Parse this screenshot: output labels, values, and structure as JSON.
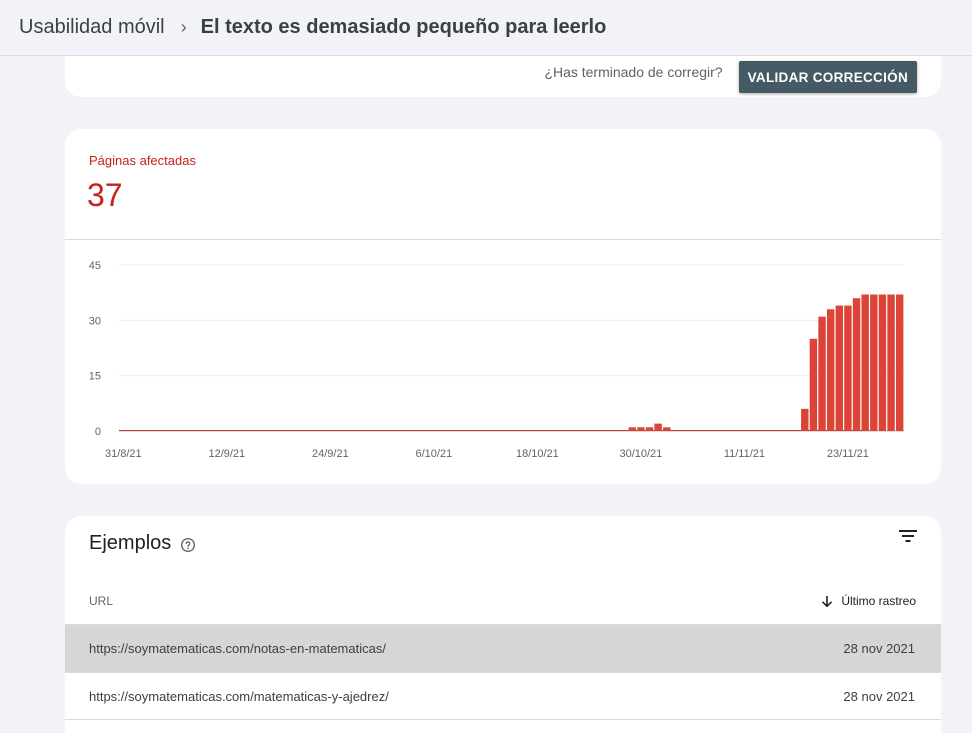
{
  "breadcrumb": {
    "parent": "Usabilidad móvil",
    "separator": "›",
    "current": "El texto es demasiado pequeño para leerlo"
  },
  "validation": {
    "question": "¿Has terminado de corregir?",
    "button_label": "VALIDAR CORRECCIÓN"
  },
  "summary": {
    "label": "Páginas afectadas",
    "count": "37"
  },
  "chart_data": {
    "type": "bar",
    "ylim": [
      0,
      45
    ],
    "yticks": [
      0,
      15,
      30,
      45
    ],
    "xtick_labels": [
      "31/8/21",
      "12/9/21",
      "24/9/21",
      "6/10/21",
      "18/10/21",
      "30/10/21",
      "11/11/21",
      "23/11/21"
    ],
    "start_date": "31/8/21",
    "end_date": "29/11/21",
    "series": [
      {
        "color": "#db4437",
        "points": [
          {
            "date": "29/10/21",
            "value": 1
          },
          {
            "date": "30/10/21",
            "value": 1
          },
          {
            "date": "31/10/21",
            "value": 1
          },
          {
            "date": "1/11/21",
            "value": 2
          },
          {
            "date": "2/11/21",
            "value": 1
          },
          {
            "date": "18/11/21",
            "value": 6
          },
          {
            "date": "19/11/21",
            "value": 25
          },
          {
            "date": "20/11/21",
            "value": 31
          },
          {
            "date": "21/11/21",
            "value": 33
          },
          {
            "date": "22/11/21",
            "value": 34
          },
          {
            "date": "23/11/21",
            "value": 34
          },
          {
            "date": "24/11/21",
            "value": 36
          },
          {
            "date": "25/11/21",
            "value": 37
          },
          {
            "date": "26/11/21",
            "value": 37
          },
          {
            "date": "27/11/21",
            "value": 37
          },
          {
            "date": "28/11/21",
            "value": 37
          },
          {
            "date": "29/11/21",
            "value": 37
          }
        ]
      }
    ]
  },
  "examples": {
    "title": "Ejemplos",
    "columns": {
      "url": "URL",
      "last_crawl": "Último rastreo"
    },
    "rows": [
      {
        "url": "https://soymatematicas.com/notas-en-matematicas/",
        "date": "28 nov 2021"
      },
      {
        "url": "https://soymatematicas.com/matematicas-y-ajedrez/",
        "date": "28 nov 2021"
      }
    ]
  },
  "icons": {
    "help": "help-circle-icon",
    "filter": "filter-icon",
    "sort": "arrow-down-icon"
  },
  "colors": {
    "error": "#c5221f",
    "bar": "#db4437",
    "button": "#455a64"
  }
}
